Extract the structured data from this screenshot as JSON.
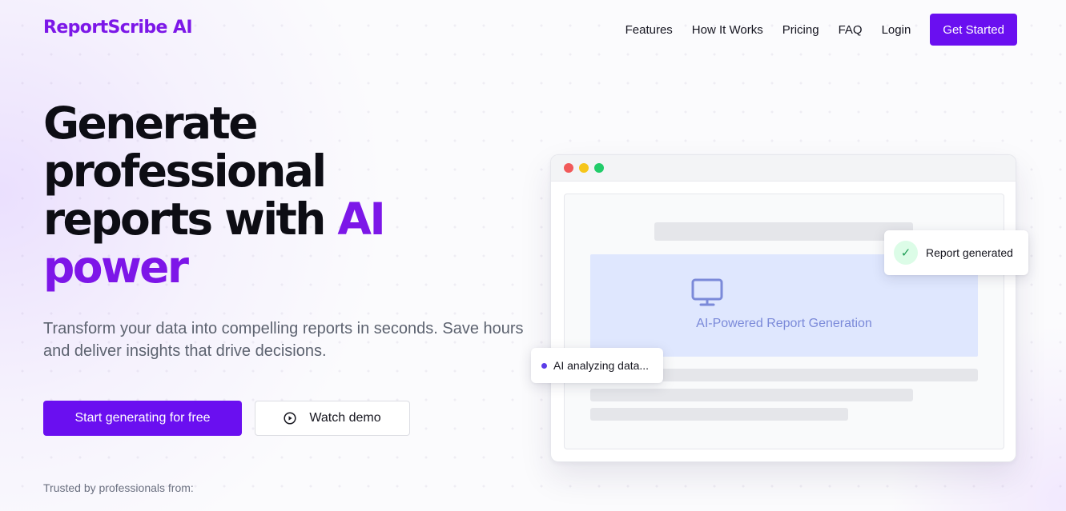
{
  "header": {
    "brand": "ReportScribe AI",
    "nav": [
      "Features",
      "How It Works",
      "Pricing",
      "FAQ",
      "Login"
    ],
    "cta": "Get Started"
  },
  "hero": {
    "headline_line1": "Generate",
    "headline_line2": "professional",
    "headline_line3_pre": "reports with",
    "headline_line3_accent": "AI",
    "headline_line4_accent": "power",
    "subtitle": "Transform your data into compelling reports in seconds. Save hours and deliver insights that drive decisions.",
    "cta_primary": "Start generating for free",
    "cta_secondary": "Watch demo",
    "trusted": "Trusted by professionals from:"
  },
  "mockup": {
    "panel_label": "AI-Powered Report Generation",
    "toast_report": "Report generated",
    "toast_ai": "AI analyzing data...",
    "icons": [
      "monitor-icon",
      "check-icon",
      "play-icon"
    ]
  },
  "colors": {
    "brand": "#7c17e8",
    "primary_button": "#6a0ff0",
    "panel_bg": "#dfe7fe",
    "success": "#1f9d55"
  }
}
